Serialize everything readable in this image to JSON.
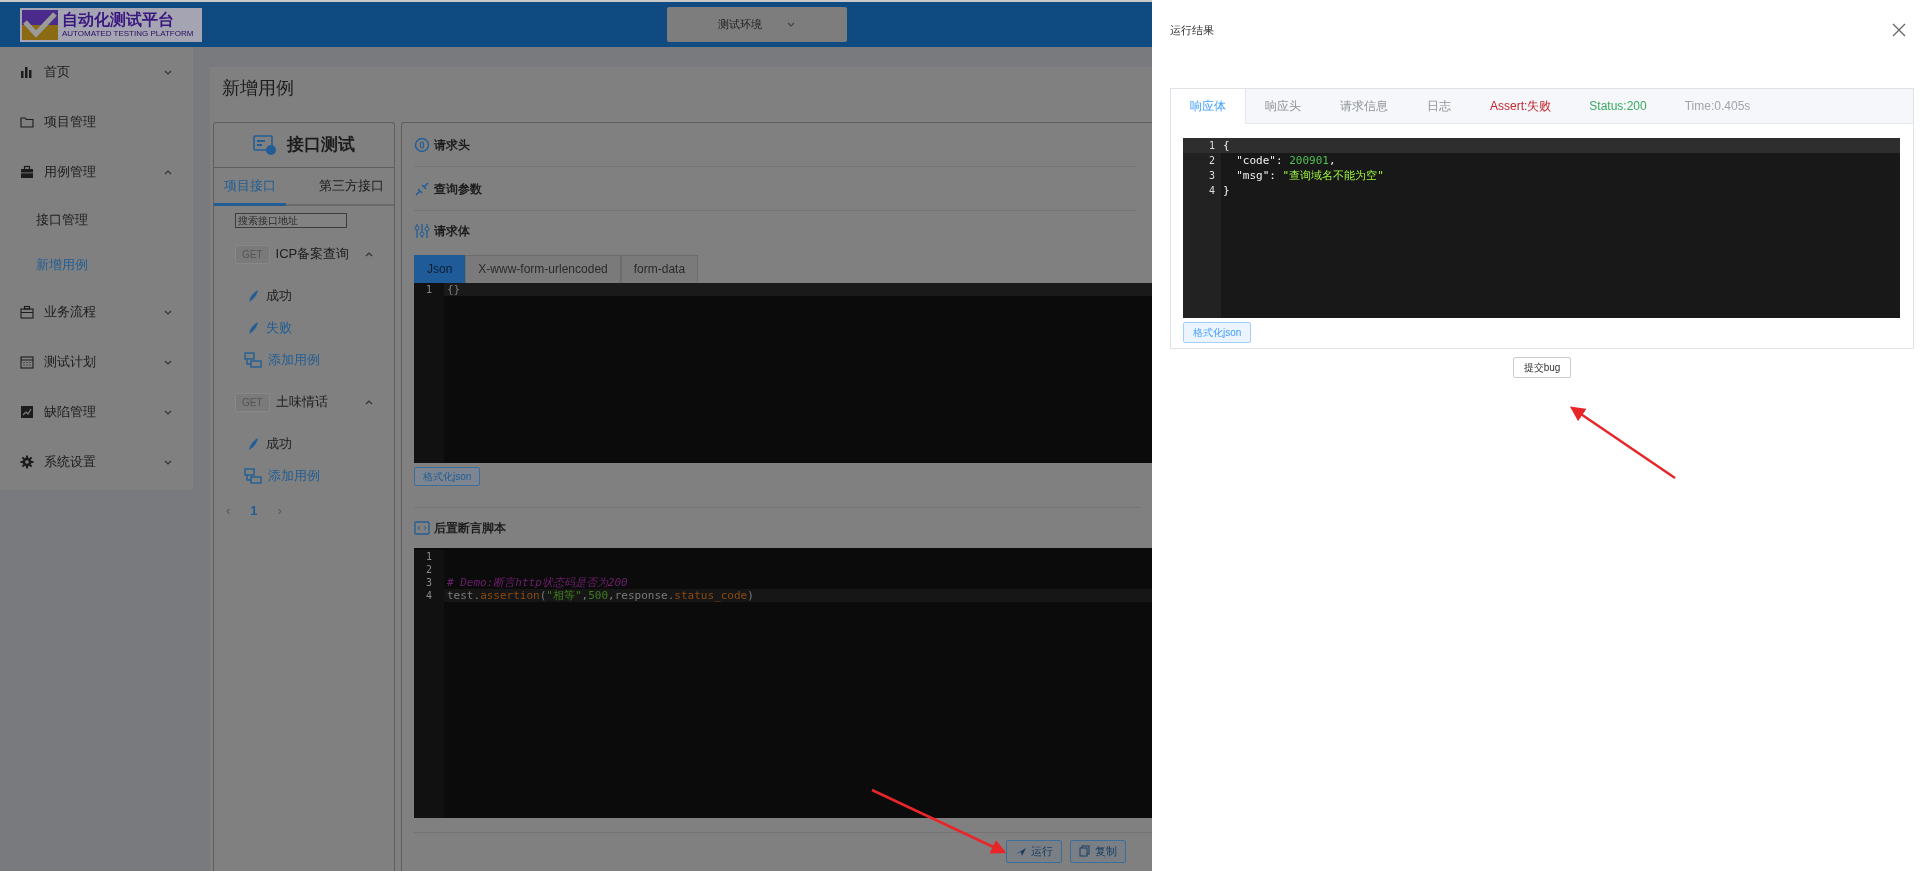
{
  "header": {
    "logo": {
      "title": "自动化测试平台",
      "subtitle": "AUTOMATED TESTING PLATFORM"
    },
    "env_select": "测试环境"
  },
  "sidebar": {
    "items": [
      {
        "label": "首页",
        "expanded": false
      },
      {
        "label": "项目管理"
      },
      {
        "label": "用例管理",
        "expanded": true,
        "children": [
          {
            "label": "接口管理",
            "selected": false
          },
          {
            "label": "新增用例",
            "selected": true
          }
        ]
      },
      {
        "label": "业务流程",
        "expanded": false
      },
      {
        "label": "测试计划",
        "expanded": false
      },
      {
        "label": "缺陷管理",
        "expanded": false
      },
      {
        "label": "系统设置",
        "expanded": false
      }
    ]
  },
  "page_title": "新增用例",
  "api_panel": {
    "title": "接口测试",
    "tabs": [
      {
        "label": "项目接口",
        "selected": true
      },
      {
        "label": "第三方接口",
        "selected": false
      }
    ],
    "search": {
      "placeholder": "搜索接口地址"
    },
    "groups": [
      {
        "method": "GET",
        "name": "ICP备案查询",
        "expanded": true,
        "cases": [
          {
            "kind": "case",
            "label": "成功",
            "selected": false
          },
          {
            "kind": "case",
            "label": "失败",
            "selected": true
          },
          {
            "kind": "add",
            "label": "添加用例"
          }
        ]
      },
      {
        "method": "GET",
        "name": "土味情话",
        "expanded": true,
        "cases": [
          {
            "kind": "case",
            "label": "成功",
            "selected": false
          },
          {
            "kind": "add",
            "label": "添加用例"
          }
        ]
      }
    ],
    "pagination": {
      "prev": "‹",
      "next": "›",
      "pages": [
        {
          "label": "1",
          "selected": true
        }
      ]
    }
  },
  "request": {
    "sections": [
      "请求头",
      "查询参数",
      "请求体"
    ],
    "body_tabs": [
      {
        "label": "Json",
        "selected": true
      },
      {
        "label": "X-www-form-urlencoded",
        "selected": false
      },
      {
        "label": "form-data",
        "selected": false
      }
    ],
    "body_lines": [
      {
        "number": "1",
        "tokens": [
          {
            "kind": "plain",
            "text": "{}"
          }
        ]
      }
    ],
    "format_button": "格式化json",
    "script_title": "后置断言脚本",
    "script_lines": [
      {
        "number": "1"
      },
      {
        "number": "2"
      },
      {
        "number": "3",
        "tokens": [
          {
            "kind": "comment",
            "text": "# Demo:断言http状态码是否为200"
          }
        ]
      },
      {
        "number": "4",
        "tokens": [
          {
            "kind": "plain",
            "text": "test."
          },
          {
            "kind": "func",
            "text": "assertion"
          },
          {
            "kind": "plain",
            "text": "("
          },
          {
            "kind": "string",
            "text": "\"相等\""
          },
          {
            "kind": "plain",
            "text": ","
          },
          {
            "kind": "number",
            "text": "500"
          },
          {
            "kind": "plain",
            "text": ",response."
          },
          {
            "kind": "func",
            "text": "status_code"
          },
          {
            "kind": "plain",
            "text": ")"
          }
        ]
      }
    ],
    "actions": [
      "运行",
      "复制"
    ]
  },
  "drawer": {
    "title": "运行结果",
    "tabs": [
      {
        "label": "响应体",
        "selected": true
      },
      {
        "label": "响应头",
        "selected": false
      },
      {
        "label": "请求信息",
        "selected": false
      },
      {
        "label": "日志",
        "selected": false
      }
    ],
    "stats": [
      {
        "label": "Assert:失败",
        "color": "#c0282d"
      },
      {
        "label": "Status:200",
        "color": "#3aa85f"
      },
      {
        "label": "Time:0.405s",
        "color": "#a0a4aa"
      }
    ],
    "response_lines": [
      {
        "number": "1",
        "tokens": [
          {
            "kind": "plain",
            "text": "{"
          }
        ]
      },
      {
        "number": "2",
        "tokens": [
          {
            "kind": "plain",
            "text": "  \"code\": "
          },
          {
            "kind": "number",
            "text": "200901"
          },
          {
            "kind": "plain",
            "text": ","
          }
        ]
      },
      {
        "number": "3",
        "tokens": [
          {
            "kind": "plain",
            "text": "  \"msg\": "
          },
          {
            "kind": "lstring",
            "text": "\"查询域名不能为空\""
          }
        ]
      },
      {
        "number": "4",
        "tokens": [
          {
            "kind": "plain",
            "text": "}"
          }
        ]
      }
    ],
    "format_button": "格式化json",
    "submit_button": "提交bug"
  }
}
